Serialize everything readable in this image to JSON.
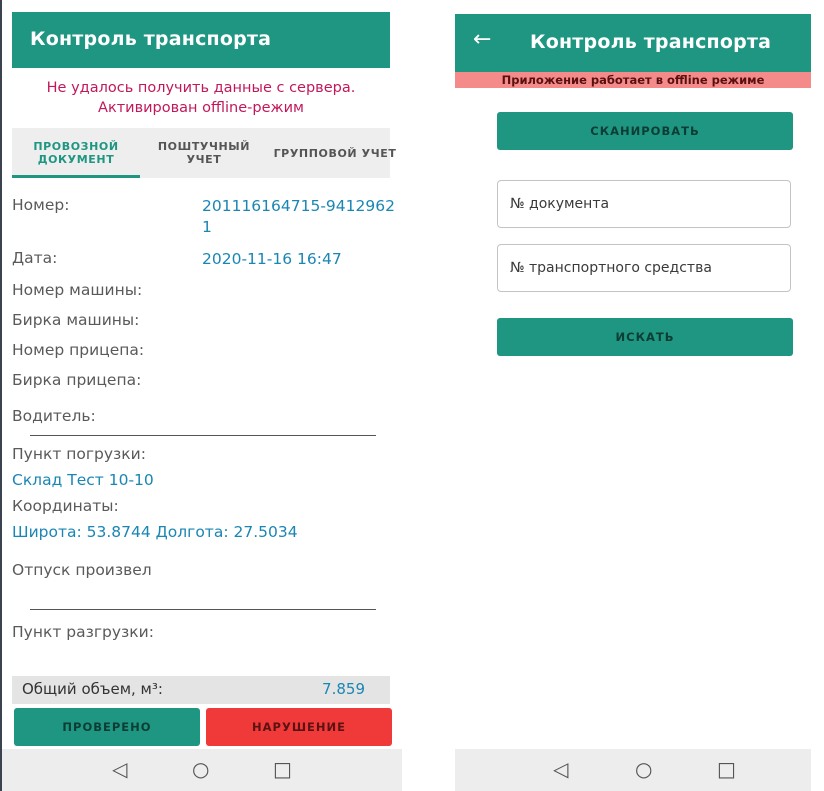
{
  "left_screen": {
    "app_title": "Контроль транспорта",
    "error_message": "Не удалось получить данные с сервера. Активирован offline-режим",
    "tabs": [
      {
        "label": "ПРОВОЗНОЙ ДОКУМЕНТ",
        "active": true
      },
      {
        "label": "ПОШТУЧНЫЙ УЧЕТ",
        "active": false
      },
      {
        "label": "ГРУППОВОЙ УЧЕТ",
        "active": false
      }
    ],
    "fields": {
      "number_label": "Номер:",
      "number_value": "201116164715-94129621",
      "date_label": "Дата:",
      "date_value": "2020-11-16 16:47",
      "car_number_label": "Номер машины:",
      "car_tag_label": "Бирка машины:",
      "trailer_number_label": "Номер прицепа:",
      "trailer_tag_label": "Бирка прицепа:",
      "driver_label": "Водитель:",
      "loading_point_label": "Пункт погрузки:",
      "loading_point_value": "Склад Тест 10-10",
      "coordinates_label": "Координаты:",
      "coordinates_value": "Широта: 53.8744 Долгота: 27.5034",
      "released_by_label": "Отпуск произвел",
      "unloading_point_label": "Пункт разгрузки:"
    },
    "total_volume_label": "Общий объем, м³:",
    "total_volume_value": "7.859",
    "buttons": {
      "checked": "ПРОВЕРЕНО",
      "violation": "НАРУШЕНИЕ"
    }
  },
  "right_screen": {
    "app_title": "Контроль транспорта",
    "offline_banner": "Приложение работает в offline режиме",
    "scan_button": "СКАНИРОВАТЬ",
    "document_input": {
      "placeholder": "№ документа",
      "value": ""
    },
    "vehicle_input": {
      "placeholder": "№ транспортного средства",
      "value": ""
    },
    "search_button": "ИСКАТЬ"
  },
  "navbar": {
    "back": "◁",
    "home": "○",
    "recents": "□"
  },
  "colors": {
    "primary": "#1e9682",
    "violation": "#f03a3a",
    "error_text": "#c2185b",
    "link_value": "#1a86b3",
    "offline_banner": "#f48a8a"
  }
}
